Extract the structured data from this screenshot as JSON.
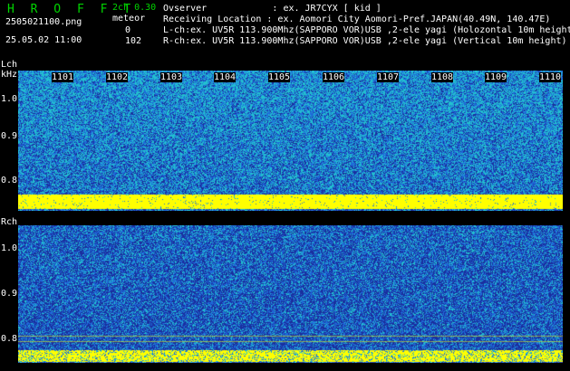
{
  "header": {
    "title": "H R O F F T",
    "filename": "2505021100.png",
    "datetime": "25.05.02 11:00",
    "mode": "2ch 0.30",
    "meteor_label": "meteor",
    "lch_count": "0",
    "rch_count": "102"
  },
  "info": {
    "observer": "Ovserver            : ex. JR7CYX [ kid ]",
    "location": "Receiving Location : ex. Aomori City Aomori-Pref.JAPAN(40.49N, 140.47E)",
    "lch": "L-ch:ex. UV5R 113.900Mhz(SAPPORO VOR)USB ,2-ele yagi (Holozontal 10m height)",
    "rch": "R-ch:ex. UV5R 113.900Mhz(SAPPORO VOR)USB ,2-ele yagi (Vertical 10m height)"
  },
  "lch_panel": {
    "label": "Lch",
    "unit": "kHz",
    "y_ticks": [
      "1.0",
      "0.9",
      "0.8"
    ],
    "time_ticks": [
      "1101",
      "1102",
      "1103",
      "1104",
      "1105",
      "1106",
      "1107",
      "1108",
      "1109",
      "1110"
    ]
  },
  "rch_panel": {
    "label": "Rch",
    "y_ticks": [
      "1.0",
      "0.9",
      "0.8"
    ]
  },
  "colors": {
    "background": "#000000",
    "header_text": "#00d400",
    "noise_dark": "#1a2f9e",
    "noise_mid": "#1e6ad8",
    "noise_cyan": "#22c0d0",
    "signal_line": "#ffff00"
  }
}
